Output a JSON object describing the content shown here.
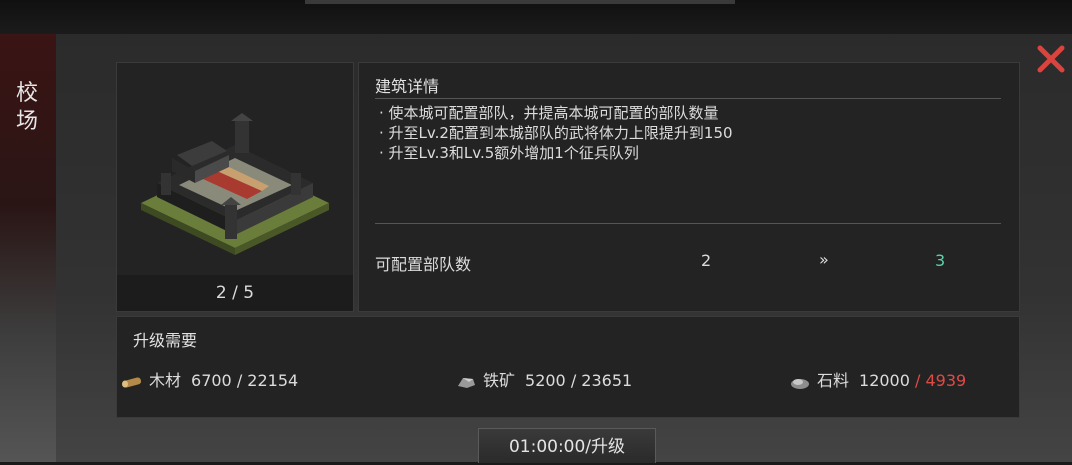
{
  "side_title": [
    "校",
    "场"
  ],
  "building": {
    "level_text": "2 / 5"
  },
  "detail": {
    "title": "建筑详情",
    "lines": [
      "· 使本城可配置部队，并提高本城可配置的部队数量",
      "· 升至Lv.2配置到本城部队的武将体力上限提升到150",
      "· 升至Lv.3和Lv.5额外增加1个征兵队列"
    ],
    "stat": {
      "label": "可配置部队数",
      "current": "2",
      "arrow": "»",
      "next": "3"
    }
  },
  "requirements": {
    "title": "升级需要",
    "items": [
      {
        "icon": "wood-icon",
        "name": "木材",
        "need": "6700",
        "sep": " / ",
        "have": "22154",
        "sufficient": true
      },
      {
        "icon": "iron-ore-icon",
        "name": "铁矿",
        "need": "5200",
        "sep": " / ",
        "have": "23651",
        "sufficient": true
      },
      {
        "icon": "stone-icon",
        "name": "石料",
        "need": "12000",
        "sep": " / ",
        "have": "4939",
        "sufficient": false
      }
    ]
  },
  "upgrade_button": "01:00:00/升级",
  "colors": {
    "next_value": "#5fd1a8",
    "insufficient": "#e04a45",
    "close": "#d9443e"
  }
}
